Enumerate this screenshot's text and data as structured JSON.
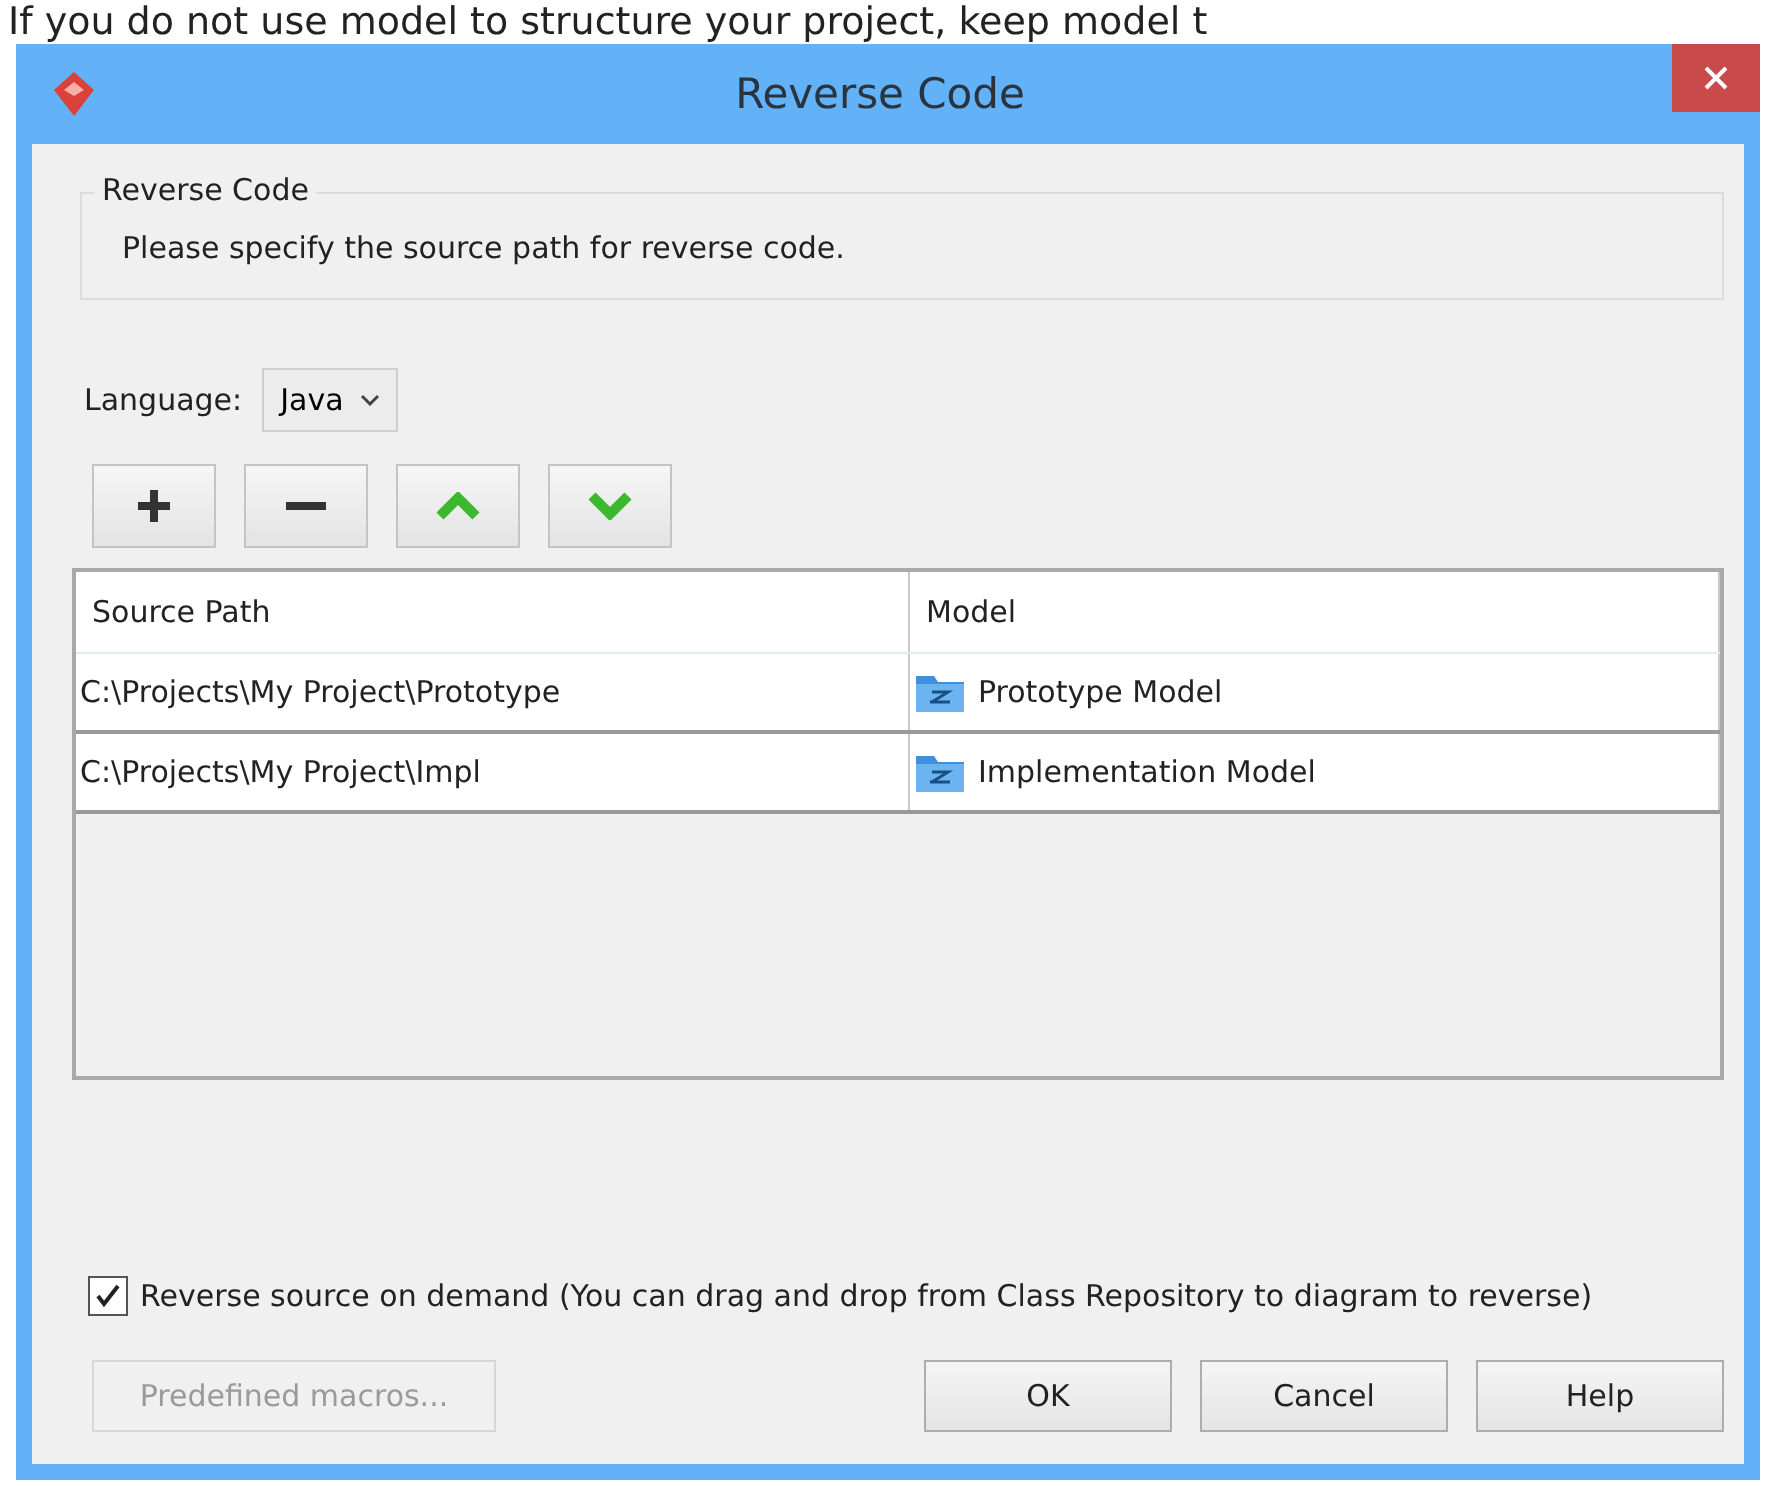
{
  "caption": "If you do not use model to structure your project, keep model t",
  "window": {
    "title": "Reverse Code"
  },
  "group": {
    "title": "Reverse Code",
    "text": "Please specify the source path for reverse code."
  },
  "language": {
    "label": "Language:",
    "value": "Java"
  },
  "toolbar": [
    {
      "kind": "add"
    },
    {
      "kind": "remove"
    },
    {
      "kind": "up"
    },
    {
      "kind": "down"
    }
  ],
  "table": {
    "columns": [
      "Source Path",
      "Model"
    ],
    "rows": [
      {
        "path": "C:\\Projects\\My Project\\Prototype",
        "model": "Prototype Model"
      },
      {
        "path": "C:\\Projects\\My Project\\Impl",
        "model": "Implementation Model"
      }
    ]
  },
  "option": {
    "label": "Reverse source on demand (You can drag and drop from Class Repository to diagram to reverse)",
    "checked": true
  },
  "buttons": [
    {
      "label": "Predefined macros...",
      "disabled": true
    },
    {
      "label": "OK",
      "disabled": false
    },
    {
      "label": "Cancel",
      "disabled": false
    },
    {
      "label": "Help",
      "disabled": false
    }
  ]
}
